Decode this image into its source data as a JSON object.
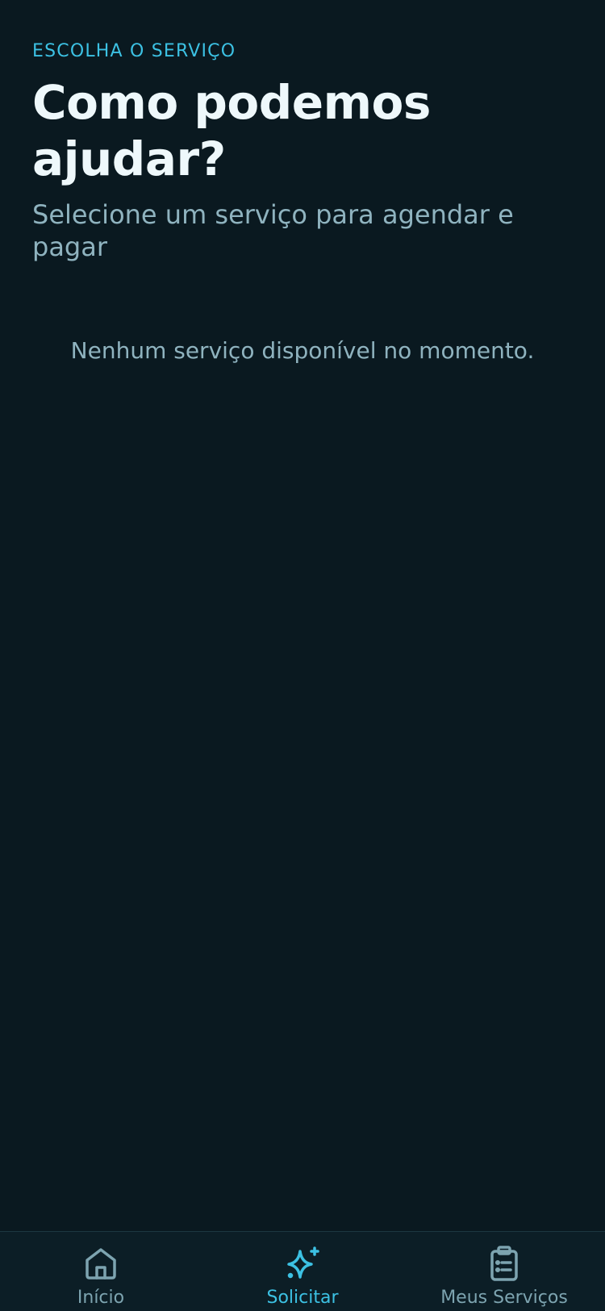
{
  "header": {
    "eyebrow": "ESCOLHA O SERVIÇO",
    "title": "Como podemos ajudar?",
    "subtitle": "Selecione um serviço para agendar e pagar"
  },
  "empty_state": {
    "message": "Nenhum serviço disponível no momento."
  },
  "bottom_nav": {
    "items": [
      {
        "label": "Início",
        "icon": "home-icon",
        "active": false
      },
      {
        "label": "Solicitar",
        "icon": "sparkle-icon",
        "active": true
      },
      {
        "label": "Meus Serviços",
        "icon": "clipboard-list-icon",
        "active": false
      }
    ]
  },
  "colors": {
    "background": "#0a1920",
    "accent": "#3cc1e3",
    "title": "#eef8fb",
    "muted": "#8fb3bf",
    "nav_inactive": "#7da4b0"
  }
}
